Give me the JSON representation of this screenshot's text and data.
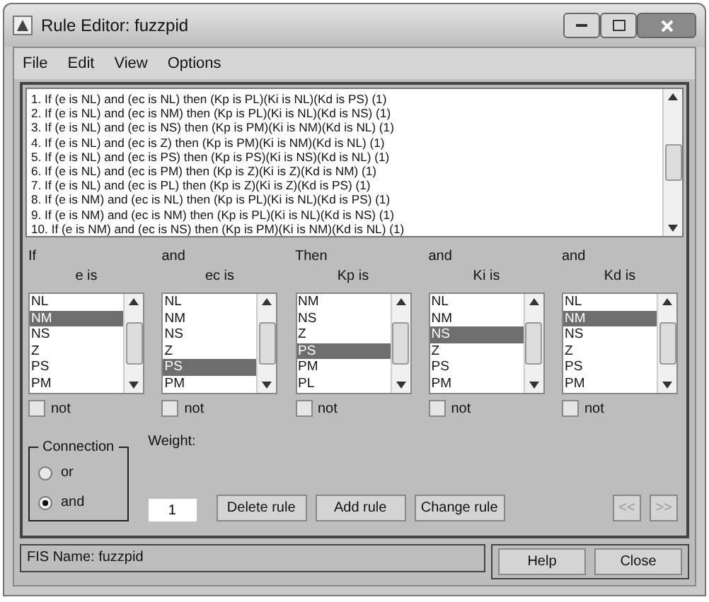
{
  "window": {
    "title": "Rule Editor: fuzzpid"
  },
  "menu": [
    "File",
    "Edit",
    "View",
    "Options"
  ],
  "rules": [
    "1. If (e is NL) and (ec is NL) then (Kp is PL)(Ki is NL)(Kd is PS) (1)",
    "2. If (e is NL) and (ec is NM) then (Kp is PL)(Ki is NL)(Kd is NS) (1)",
    "3. If (e is NL) and (ec is NS) then (Kp is PM)(Ki is NM)(Kd is NL) (1)",
    "4. If (e is NL) and (ec is Z) then (Kp is PM)(Ki is NM)(Kd is NL) (1)",
    "5. If (e is NL) and (ec is PS) then (Kp is PS)(Ki is NS)(Kd is NL) (1)",
    "6. If (e is NL) and (ec is PM) then (Kp is Z)(Ki is Z)(Kd is NM) (1)",
    "7. If (e is NL) and (ec is PL) then (Kp is Z)(Ki is Z)(Kd is PS) (1)",
    "8. If (e is NM) and (ec is NL) then (Kp is PL)(Ki is NL)(Kd is PS) (1)",
    "9. If (e is NM) and (ec is NM) then (Kp is PL)(Ki is NL)(Kd is NS) (1)",
    "10. If (e is NM) and (ec is NS) then (Kp is PM)(Ki is NM)(Kd is NL) (1)"
  ],
  "variables": [
    {
      "header": "If",
      "label": "e is",
      "not_label": "not",
      "not_checked": false,
      "items": [
        {
          "text": "NL",
          "selected": false
        },
        {
          "text": "NM",
          "selected": true
        },
        {
          "text": "NS",
          "selected": false
        },
        {
          "text": "Z",
          "selected": false
        },
        {
          "text": "PS",
          "selected": false
        },
        {
          "text": "PM",
          "selected": false
        }
      ]
    },
    {
      "header": "and",
      "label": "ec is",
      "not_label": "not",
      "not_checked": false,
      "items": [
        {
          "text": "NL",
          "selected": false
        },
        {
          "text": "NM",
          "selected": false
        },
        {
          "text": "NS",
          "selected": false
        },
        {
          "text": "Z",
          "selected": false
        },
        {
          "text": "PS",
          "selected": true
        },
        {
          "text": "PM",
          "selected": false
        }
      ]
    },
    {
      "header": "Then",
      "label": "Kp is",
      "not_label": "not",
      "not_checked": false,
      "items": [
        {
          "text": "NM",
          "selected": false
        },
        {
          "text": "NS",
          "selected": false
        },
        {
          "text": "Z",
          "selected": false
        },
        {
          "text": "PS",
          "selected": true
        },
        {
          "text": "PM",
          "selected": false
        },
        {
          "text": "PL",
          "selected": false
        }
      ]
    },
    {
      "header": "and",
      "label": "Ki is",
      "not_label": "not",
      "not_checked": false,
      "items": [
        {
          "text": "NL",
          "selected": false
        },
        {
          "text": "NM",
          "selected": false
        },
        {
          "text": "NS",
          "selected": true
        },
        {
          "text": "Z",
          "selected": false
        },
        {
          "text": "PS",
          "selected": false
        },
        {
          "text": "PM",
          "selected": false
        }
      ]
    },
    {
      "header": "and",
      "label": "Kd is",
      "not_label": "not",
      "not_checked": false,
      "items": [
        {
          "text": "NL",
          "selected": false
        },
        {
          "text": "NM",
          "selected": true
        },
        {
          "text": "NS",
          "selected": false
        },
        {
          "text": "Z",
          "selected": false
        },
        {
          "text": "PS",
          "selected": false
        },
        {
          "text": "PM",
          "selected": false
        }
      ]
    }
  ],
  "connection": {
    "title": "Connection",
    "options": [
      {
        "label": "or",
        "selected": false
      },
      {
        "label": "and",
        "selected": true
      }
    ]
  },
  "weight": {
    "label": "Weight:",
    "value": "1"
  },
  "buttons": [
    {
      "label": "Delete rule",
      "disabled": false
    },
    {
      "label": "Add rule",
      "disabled": false
    },
    {
      "label": "Change rule",
      "disabled": false
    }
  ],
  "nav_buttons": [
    {
      "label": "<<",
      "disabled": true
    },
    {
      "label": ">>",
      "disabled": true
    }
  ],
  "status": "FIS Name: fuzzpid",
  "footer_buttons": [
    "Help",
    "Close"
  ]
}
